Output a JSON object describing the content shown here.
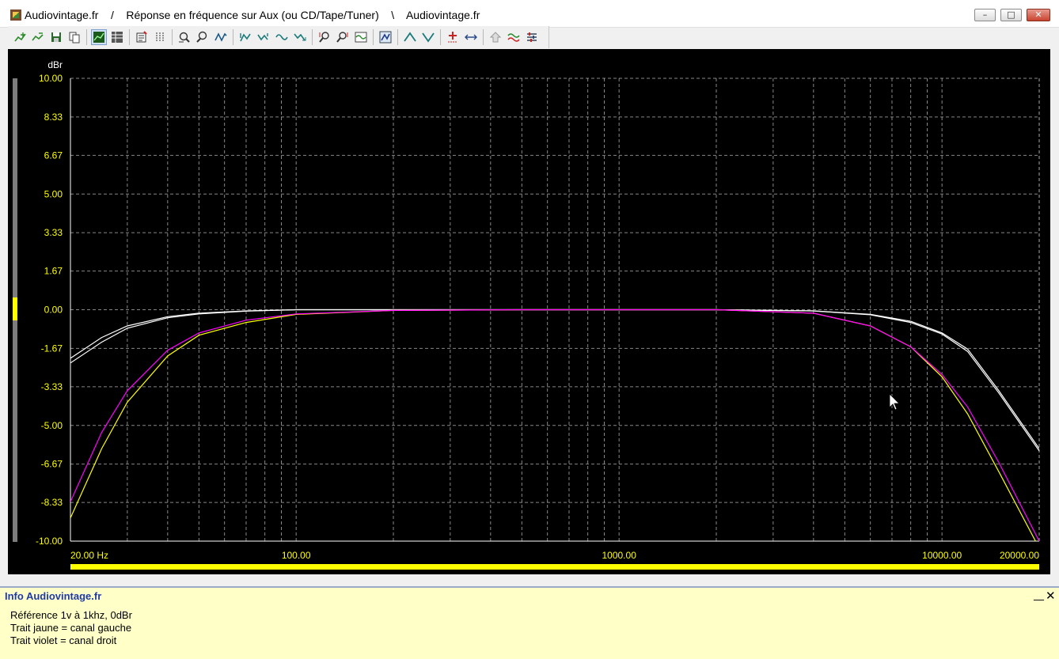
{
  "window": {
    "title": "Audiovintage.fr    /    Réponse en fréquence sur Aux (ou CD/Tape/Tuner)    \\    Audiovintage.fr",
    "min_label": "–",
    "max_label": "□",
    "close_label": "✕"
  },
  "toolbar": {
    "buttons": [
      "add-trace",
      "remove-trace",
      "save",
      "copy",
      "graph-view",
      "table-view",
      "properties",
      "grid",
      "zoom-in",
      "zoom-out",
      "fit",
      "prev-trace",
      "next-trace",
      "smooth",
      "invert",
      "marker-left",
      "marker-right",
      "wave",
      "analyze",
      "peak-up",
      "peak-down",
      "add-point",
      "swap",
      "up",
      "compare",
      "settings"
    ]
  },
  "plot": {
    "colors": {
      "background": "#000000",
      "grid": "#b4b4b4",
      "axis_label": "#ffff00",
      "unit_label": "#ffffff",
      "left_channel": "#ffff00",
      "right_channel": "#ff00ff",
      "reference": "#ffffff"
    },
    "frequency_bar_color": "#ffff00"
  },
  "chart_data": {
    "type": "line",
    "title": "",
    "ylabel": "dBr",
    "xlabel": "",
    "x_scale": "log",
    "xlim": [
      20,
      20000
    ],
    "ylim": [
      -10,
      10
    ],
    "y_ticks": [
      "10.00",
      "8.33",
      "6.67",
      "5.00",
      "3.33",
      "1.67",
      "0.00",
      "-1.67",
      "-3.33",
      "-5.00",
      "-6.67",
      "-8.33",
      "-10.00"
    ],
    "y_tick_values": [
      10,
      8.33,
      6.67,
      5,
      3.33,
      1.67,
      0,
      -1.67,
      -3.33,
      -5,
      -6.67,
      -8.33,
      -10
    ],
    "x_ticks": [
      {
        "value": 20,
        "label": "20.00 Hz"
      },
      {
        "value": 100,
        "label": "100.00"
      },
      {
        "value": 1000,
        "label": "1000.00"
      },
      {
        "value": 10000,
        "label": "10000.00"
      },
      {
        "value": 20000,
        "label": "20000.00"
      }
    ],
    "grid": true,
    "series": [
      {
        "color": "#ffffff",
        "x": [
          20,
          25,
          30,
          40,
          50,
          70,
          100,
          200,
          500,
          1000,
          2000,
          4000,
          6000,
          8000,
          10000,
          12000,
          15000,
          20000
        ],
        "y": [
          -2.1,
          -1.2,
          -0.7,
          -0.3,
          -0.15,
          -0.05,
          0,
          0,
          0,
          0,
          0,
          -0.05,
          -0.2,
          -0.5,
          -1.0,
          -1.7,
          -3.5,
          -6.0
        ]
      },
      {
        "color": "#ffffff",
        "x": [
          20,
          25,
          30,
          40,
          50,
          70,
          100,
          200,
          500,
          1000,
          2000,
          4000,
          6000,
          8000,
          10000,
          12000,
          15000,
          20000
        ],
        "y": [
          -2.3,
          -1.4,
          -0.8,
          -0.35,
          -0.18,
          -0.06,
          0,
          0,
          0,
          0,
          0,
          -0.05,
          -0.22,
          -0.55,
          -1.05,
          -1.8,
          -3.6,
          -6.1
        ]
      },
      {
        "color": "#ffff00",
        "x": [
          20,
          25,
          30,
          40,
          50,
          70,
          100,
          200,
          500,
          1000,
          2000,
          4000,
          6000,
          8000,
          10000,
          12000,
          15000,
          20000
        ],
        "y": [
          -9.0,
          -6.0,
          -4.0,
          -2.0,
          -1.1,
          -0.55,
          -0.2,
          -0.03,
          0,
          0,
          0,
          -0.15,
          -0.7,
          -1.6,
          -2.9,
          -4.5,
          -7.0,
          -10.3
        ]
      },
      {
        "color": "#ff00ff",
        "x": [
          20,
          25,
          30,
          40,
          50,
          70,
          100,
          200,
          500,
          1000,
          2000,
          4000,
          6000,
          8000,
          10000,
          12000,
          15000,
          20000
        ],
        "y": [
          -8.3,
          -5.3,
          -3.5,
          -1.75,
          -1.0,
          -0.45,
          -0.18,
          -0.03,
          0,
          0,
          0,
          -0.15,
          -0.7,
          -1.6,
          -2.8,
          -4.2,
          -6.6,
          -10.0
        ]
      }
    ]
  },
  "info": {
    "title": "Info Audiovintage.fr",
    "lines": [
      "Référence 1v à 1khz, 0dBr",
      "Trait jaune = canal gauche",
      "Trait violet = canal droit"
    ],
    "minimize_label": "__",
    "close_label": "✕"
  }
}
